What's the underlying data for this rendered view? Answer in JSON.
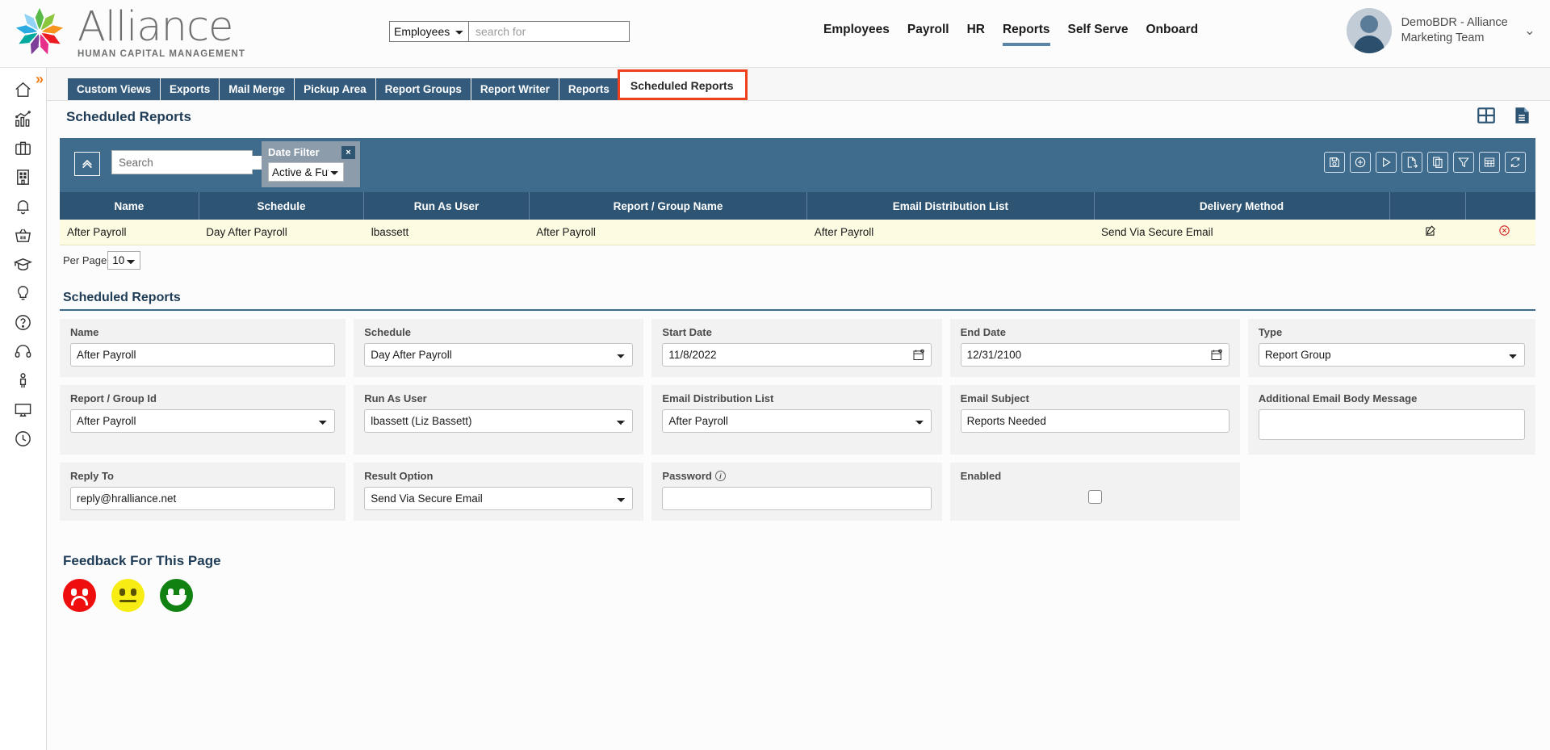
{
  "header": {
    "brand_name": "Alliance",
    "brand_tagline": "HUMAN CAPITAL MANAGEMENT",
    "search_scope_selected": "Employees",
    "search_scope_options": [
      "Employees"
    ],
    "search_placeholder": "search for",
    "search_value": "",
    "nav": [
      {
        "label": "Employees",
        "active": false
      },
      {
        "label": "Payroll",
        "active": false
      },
      {
        "label": "HR",
        "active": false
      },
      {
        "label": "Reports",
        "active": true
      },
      {
        "label": "Self Serve",
        "active": false
      },
      {
        "label": "Onboard",
        "active": false
      }
    ],
    "user_line1": "DemoBDR - Alliance",
    "user_line2": "Marketing Team",
    "user_caret": "chevron-down-icon"
  },
  "sidebar": {
    "expand_label": "»",
    "items": [
      {
        "icon": "home-icon",
        "name": "home"
      },
      {
        "icon": "analytics-icon",
        "name": "analytics"
      },
      {
        "icon": "briefcase-icon",
        "name": "briefcase"
      },
      {
        "icon": "building-icon",
        "name": "company"
      },
      {
        "icon": "bell-icon",
        "name": "notifications"
      },
      {
        "icon": "basket-icon",
        "name": "marketplace"
      },
      {
        "icon": "graduation-cap-icon",
        "name": "learning"
      },
      {
        "icon": "lightbulb-icon",
        "name": "ideas"
      },
      {
        "icon": "question-circle-icon",
        "name": "help"
      },
      {
        "icon": "headset-icon",
        "name": "support"
      },
      {
        "icon": "person-icon",
        "name": "profile"
      },
      {
        "icon": "monitor-icon",
        "name": "desktop"
      },
      {
        "icon": "clock-icon",
        "name": "time"
      }
    ]
  },
  "tabs": [
    {
      "label": "Custom Views",
      "active": false,
      "highlighted": false
    },
    {
      "label": "Exports",
      "active": false,
      "highlighted": false
    },
    {
      "label": "Mail Merge",
      "active": false,
      "highlighted": false
    },
    {
      "label": "Pickup Area",
      "active": false,
      "highlighted": false
    },
    {
      "label": "Report Groups",
      "active": false,
      "highlighted": false
    },
    {
      "label": "Report Writer",
      "active": false,
      "highlighted": false
    },
    {
      "label": "Reports",
      "active": false,
      "highlighted": false
    },
    {
      "label": "Scheduled Reports",
      "active": true,
      "highlighted": true
    }
  ],
  "page": {
    "title": "Scheduled Reports",
    "head_icons": [
      {
        "name": "dashboard-grid-icon"
      },
      {
        "name": "document-icon"
      }
    ],
    "annotation": {
      "type": "red-arrow",
      "color": "#f4553c"
    }
  },
  "filterbar": {
    "collapse_icon": "chevron-up-icon",
    "search_placeholder": "Search",
    "search_value": "",
    "search_icon": "search-icon",
    "date_filter_label": "Date Filter",
    "date_filter_selected": "Active & Future",
    "date_filter_options": [
      "Active & Future"
    ],
    "date_filter_close": "×",
    "tools": [
      {
        "name": "save-icon",
        "title": "Save"
      },
      {
        "name": "add-circle-icon",
        "title": "Add"
      },
      {
        "name": "run-play-icon",
        "title": "Run"
      },
      {
        "name": "export-doc-icon",
        "title": "Export"
      },
      {
        "name": "copy-icon",
        "title": "Copy"
      },
      {
        "name": "filter-funnel-icon",
        "title": "Filter"
      },
      {
        "name": "table-grid-icon",
        "title": "Columns"
      },
      {
        "name": "refresh-sync-icon",
        "title": "Refresh"
      }
    ]
  },
  "table": {
    "columns": [
      "Name",
      "Schedule",
      "Run As User",
      "Report / Group Name",
      "Email Distribution List",
      "Delivery Method",
      "",
      ""
    ],
    "rows": [
      {
        "name": "After Payroll",
        "schedule": "Day After Payroll",
        "run_as_user": "lbassett",
        "report_group_name": "After Payroll",
        "email_distribution_list": "After Payroll",
        "delivery_method": "Send Via Secure Email",
        "edit_icon": "edit-pencil-icon",
        "delete_icon": "delete-circle-icon"
      }
    ],
    "per_page_label": "Per Page",
    "per_page_selected": "10",
    "per_page_options": [
      "10"
    ]
  },
  "detail": {
    "section_title": "Scheduled Reports",
    "fields": {
      "name": {
        "label": "Name",
        "value": "After Payroll"
      },
      "schedule": {
        "label": "Schedule",
        "value": "Day After Payroll"
      },
      "start_date": {
        "label": "Start Date",
        "value": "11/8/2022",
        "icon": "calendar-icon"
      },
      "end_date": {
        "label": "End Date",
        "value": "12/31/2100",
        "icon": "calendar-icon"
      },
      "type": {
        "label": "Type",
        "value": "Report Group"
      },
      "report_group_id": {
        "label": "Report / Group Id",
        "value": "After Payroll"
      },
      "run_as_user": {
        "label": "Run As User",
        "value": "lbassett (Liz Bassett)"
      },
      "email_distribution_list": {
        "label": "Email Distribution List",
        "value": "After Payroll"
      },
      "email_subject": {
        "label": "Email Subject",
        "value": "Reports Needed"
      },
      "additional_email_body": {
        "label": "Additional Email Body Message",
        "value": ""
      },
      "reply_to": {
        "label": "Reply To",
        "value": "reply@hralliance.net"
      },
      "result_option": {
        "label": "Result Option",
        "value": "Send Via Secure Email"
      },
      "password": {
        "label": "Password",
        "value": "",
        "info_icon": "info-icon"
      },
      "enabled": {
        "label": "Enabled",
        "checked": false
      }
    }
  },
  "feedback": {
    "title": "Feedback For This Page",
    "faces": [
      {
        "name": "sad-face-icon",
        "color": "#ee0e0e"
      },
      {
        "name": "neutral-face-icon",
        "color": "#f7ec13"
      },
      {
        "name": "happy-face-icon",
        "color": "#118211"
      }
    ]
  }
}
